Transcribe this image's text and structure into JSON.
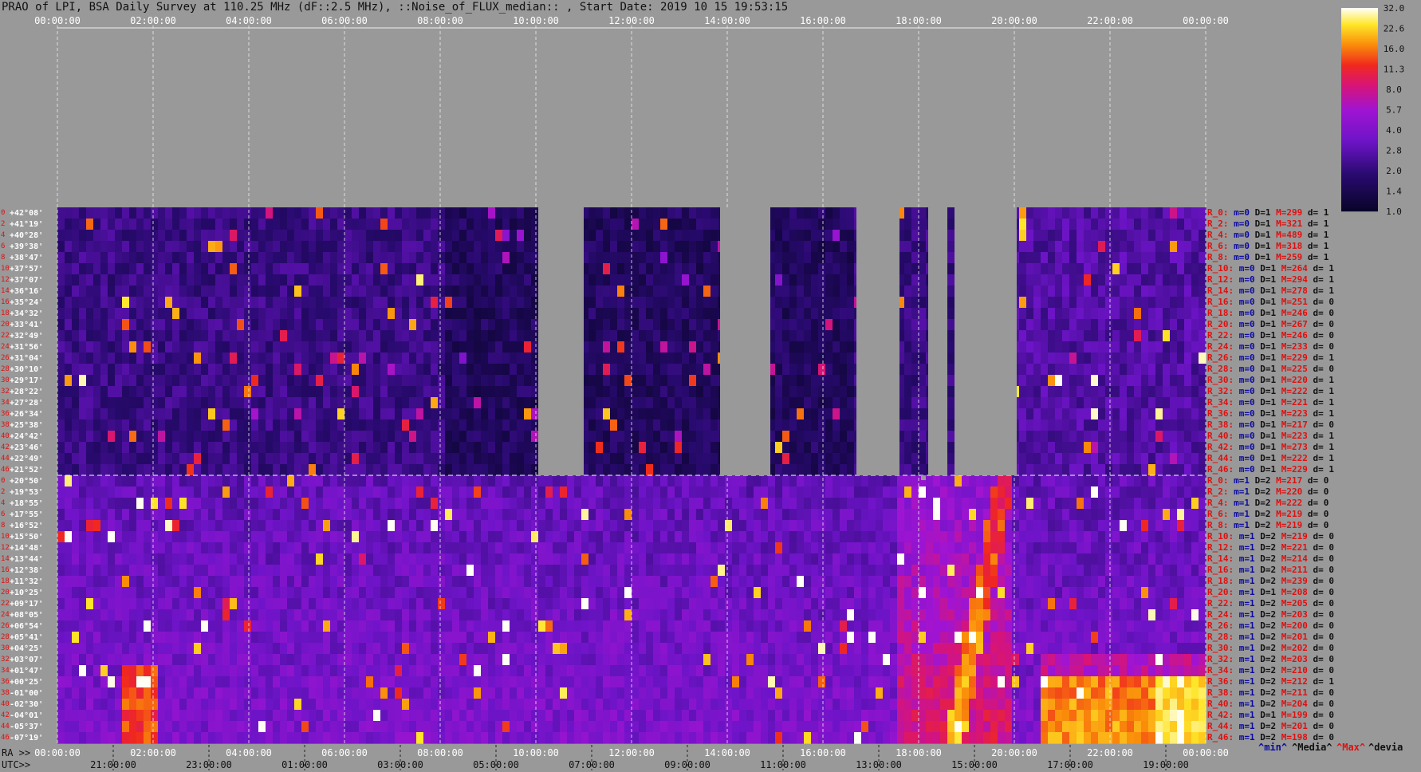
{
  "title": "PRAO of LPI, BSA Daily Survey at 110.25 MHz (dF::2.5 MHz), ::Noise_of_FLUX_median:: , Start Date: 2019 10 15 19:53:15",
  "top_time_labels": [
    "00:00:00",
    "02:00:00",
    "04:00:00",
    "06:00:00",
    "08:00:00",
    "10:00:00",
    "12:00:00",
    "14:00:00",
    "16:00:00",
    "18:00:00",
    "20:00:00",
    "22:00:00",
    "00:00:00"
  ],
  "ra_prefix": "RA >>",
  "ra_labels": [
    "00:00:00",
    "02:00:00",
    "04:00:00",
    "06:00:00",
    "08:00:00",
    "10:00:00",
    "12:00:00",
    "14:00:00",
    "16:00:00",
    "18:00:00",
    "20:00:00",
    "22:00:00",
    "00:00:00"
  ],
  "utc_prefix": "UTC>>",
  "utc_labels": [
    "21:00:00",
    "23:00:00",
    "01:00:00",
    "03:00:00",
    "05:00:00",
    "07:00:00",
    "09:00:00",
    "11:00:00",
    "13:00:00",
    "15:00:00",
    "17:00:00",
    "19:00:00"
  ],
  "colorbar": {
    "ticks": [
      "32.0",
      "22.6",
      "16.0",
      "11.3",
      "8.0",
      "5.7",
      "4.0",
      "2.8",
      "2.0",
      "1.4",
      "1.0"
    ]
  },
  "legend": {
    "min": "^min^",
    "median": "^Media^",
    "max": "^Max^",
    "devia": "^devia"
  },
  "colors": {
    "background": "#999999",
    "panel_gap": "#999999",
    "row_label_red": "#e01010",
    "stat_blue": "#0a0aa0",
    "stat_red": "#e01010"
  },
  "chart_data": {
    "type": "heatmap",
    "frequency_mhz": 110.25,
    "bandwidth_mhz": 2.5,
    "quantity": "Noise_of_FLUX_median",
    "start_date": "2019 10 15 19:53:15",
    "colorscale_range": [
      1.0,
      32.0
    ],
    "upper_panel_declinations": [
      "+42°08'",
      "+41°19'",
      "+40°28'",
      "+39°38'",
      "+38°47'",
      "+37°57'",
      "+37°07'",
      "+36°16'",
      "+35°24'",
      "+34°32'",
      "+33°41'",
      "+32°49'",
      "+31°56'",
      "+31°04'",
      "+30°10'",
      "+29°17'",
      "+28°22'",
      "+27°28'",
      "+26°34'",
      "+25°38'",
      "+24°42'",
      "+23°46'",
      "+22°49'",
      "+21°52'"
    ],
    "lower_panel_declinations": [
      "+20°50'",
      "+19°53'",
      "+18°55'",
      "+17°55'",
      "+16°52'",
      "+15°50'",
      "+14°48'",
      "+13°44'",
      "+12°38'",
      "+11°32'",
      "+10°25'",
      "+09°17'",
      "+08°05'",
      "+06°54'",
      "+05°41'",
      "+04°25'",
      "+03°07'",
      "+01°47'",
      "+00°25'",
      "-01°00'",
      "-02°30'",
      "-04°01'",
      "-05°37'",
      "-07°19'"
    ],
    "upper_row_numbers": [
      "0",
      "2",
      "4",
      "6",
      "8",
      "10",
      "12",
      "14",
      "16",
      "18",
      "20",
      "22",
      "24",
      "26",
      "28",
      "30",
      "32",
      "34",
      "36",
      "38",
      "40",
      "42",
      "44",
      "46"
    ],
    "lower_row_numbers": [
      "0",
      "2",
      "4",
      "6",
      "8",
      "10",
      "12",
      "14",
      "16",
      "18",
      "20",
      "22",
      "24",
      "26",
      "28",
      "30",
      "32",
      "34",
      "36",
      "38",
      "40",
      "42",
      "44",
      "46"
    ],
    "upper_stats": [
      {
        "r": "R_0:",
        "m": "m=0",
        "D": "D=1",
        "M": "M=299",
        "d": "d= 1"
      },
      {
        "r": "R_2:",
        "m": "m=0",
        "D": "D=1",
        "M": "M=321",
        "d": "d= 1"
      },
      {
        "r": "R_4:",
        "m": "m=0",
        "D": "D=1",
        "M": "M=489",
        "d": "d= 1"
      },
      {
        "r": "R_6:",
        "m": "m=0",
        "D": "D=1",
        "M": "M=318",
        "d": "d= 1"
      },
      {
        "r": "R_8:",
        "m": "m=0",
        "D": "D=1",
        "M": "M=259",
        "d": "d= 1"
      },
      {
        "r": "R_10:",
        "m": "m=0",
        "D": "D=1",
        "M": "M=264",
        "d": "d= 1"
      },
      {
        "r": "R_12:",
        "m": "m=0",
        "D": "D=1",
        "M": "M=294",
        "d": "d= 1"
      },
      {
        "r": "R_14:",
        "m": "m=0",
        "D": "D=1",
        "M": "M=278",
        "d": "d= 1"
      },
      {
        "r": "R_16:",
        "m": "m=0",
        "D": "D=1",
        "M": "M=251",
        "d": "d= 0"
      },
      {
        "r": "R_18:",
        "m": "m=0",
        "D": "D=1",
        "M": "M=246",
        "d": "d= 0"
      },
      {
        "r": "R_20:",
        "m": "m=0",
        "D": "D=1",
        "M": "M=267",
        "d": "d= 0"
      },
      {
        "r": "R_22:",
        "m": "m=0",
        "D": "D=1",
        "M": "M=246",
        "d": "d= 0"
      },
      {
        "r": "R_24:",
        "m": "m=0",
        "D": "D=1",
        "M": "M=233",
        "d": "d= 0"
      },
      {
        "r": "R_26:",
        "m": "m=0",
        "D": "D=1",
        "M": "M=229",
        "d": "d= 1"
      },
      {
        "r": "R_28:",
        "m": "m=0",
        "D": "D=1",
        "M": "M=225",
        "d": "d= 0"
      },
      {
        "r": "R_30:",
        "m": "m=0",
        "D": "D=1",
        "M": "M=220",
        "d": "d= 1"
      },
      {
        "r": "R_32:",
        "m": "m=0",
        "D": "D=1",
        "M": "M=222",
        "d": "d= 1"
      },
      {
        "r": "R_34:",
        "m": "m=0",
        "D": "D=1",
        "M": "M=221",
        "d": "d= 1"
      },
      {
        "r": "R_36:",
        "m": "m=0",
        "D": "D=1",
        "M": "M=223",
        "d": "d= 1"
      },
      {
        "r": "R_38:",
        "m": "m=0",
        "D": "D=1",
        "M": "M=217",
        "d": "d= 0"
      },
      {
        "r": "R_40:",
        "m": "m=0",
        "D": "D=1",
        "M": "M=223",
        "d": "d= 1"
      },
      {
        "r": "R_42:",
        "m": "m=0",
        "D": "D=1",
        "M": "M=273",
        "d": "d= 1"
      },
      {
        "r": "R_44:",
        "m": "m=0",
        "D": "D=1",
        "M": "M=222",
        "d": "d= 1"
      },
      {
        "r": "R_46:",
        "m": "m=0",
        "D": "D=1",
        "M": "M=229",
        "d": "d= 1"
      }
    ],
    "lower_stats": [
      {
        "r": "R_0:",
        "m": "m=1",
        "D": "D=2",
        "M": "M=217",
        "d": "d= 0"
      },
      {
        "r": "R_2:",
        "m": "m=1",
        "D": "D=2",
        "M": "M=220",
        "d": "d= 0"
      },
      {
        "r": "R_4:",
        "m": "m=1",
        "D": "D=2",
        "M": "M=222",
        "d": "d= 0"
      },
      {
        "r": "R_6:",
        "m": "m=1",
        "D": "D=2",
        "M": "M=219",
        "d": "d= 0"
      },
      {
        "r": "R_8:",
        "m": "m=1",
        "D": "D=2",
        "M": "M=219",
        "d": "d= 0"
      },
      {
        "r": "R_10:",
        "m": "m=1",
        "D": "D=2",
        "M": "M=219",
        "d": "d= 0"
      },
      {
        "r": "R_12:",
        "m": "m=1",
        "D": "D=2",
        "M": "M=221",
        "d": "d= 0"
      },
      {
        "r": "R_14:",
        "m": "m=1",
        "D": "D=2",
        "M": "M=214",
        "d": "d= 0"
      },
      {
        "r": "R_16:",
        "m": "m=1",
        "D": "D=2",
        "M": "M=211",
        "d": "d= 0"
      },
      {
        "r": "R_18:",
        "m": "m=1",
        "D": "D=2",
        "M": "M=239",
        "d": "d= 0"
      },
      {
        "r": "R_20:",
        "m": "m=1",
        "D": "D=1",
        "M": "M=208",
        "d": "d= 0"
      },
      {
        "r": "R_22:",
        "m": "m=1",
        "D": "D=2",
        "M": "M=205",
        "d": "d= 0"
      },
      {
        "r": "R_24:",
        "m": "m=1",
        "D": "D=2",
        "M": "M=203",
        "d": "d= 0"
      },
      {
        "r": "R_26:",
        "m": "m=1",
        "D": "D=2",
        "M": "M=200",
        "d": "d= 0"
      },
      {
        "r": "R_28:",
        "m": "m=1",
        "D": "D=2",
        "M": "M=201",
        "d": "d= 0"
      },
      {
        "r": "R_30:",
        "m": "m=1",
        "D": "D=2",
        "M": "M=202",
        "d": "d= 0"
      },
      {
        "r": "R_32:",
        "m": "m=1",
        "D": "D=2",
        "M": "M=203",
        "d": "d= 0"
      },
      {
        "r": "R_34:",
        "m": "m=1",
        "D": "D=2",
        "M": "M=210",
        "d": "d= 0"
      },
      {
        "r": "R_36:",
        "m": "m=1",
        "D": "D=2",
        "M": "M=212",
        "d": "d= 1"
      },
      {
        "r": "R_38:",
        "m": "m=1",
        "D": "D=2",
        "M": "M=211",
        "d": "d= 0"
      },
      {
        "r": "R_40:",
        "m": "m=1",
        "D": "D=2",
        "M": "M=204",
        "d": "d= 0"
      },
      {
        "r": "R_42:",
        "m": "m=1",
        "D": "D=1",
        "M": "M=199",
        "d": "d= 0"
      },
      {
        "r": "R_44:",
        "m": "m=1",
        "D": "D=2",
        "M": "M=201",
        "d": "d= 0"
      },
      {
        "r": "R_46:",
        "m": "m=1",
        "D": "D=2",
        "M": "M=198",
        "d": "d= 0"
      }
    ],
    "data_gaps_upper_ra_hours": [
      [
        10.05,
        11.0
      ],
      [
        13.85,
        14.9
      ],
      [
        16.7,
        17.6
      ],
      [
        18.2,
        18.6
      ],
      [
        18.75,
        20.05
      ]
    ],
    "data_gaps_lower_ra_hours": [
      [
        18.05,
        18.15
      ]
    ],
    "bright_features": [
      {
        "ra_hours": 1.45,
        "dec_panel": "lower",
        "rows": [
          17,
          23
        ],
        "level": 8.0
      },
      {
        "ra_hours": 21.0,
        "dec_panel": "lower",
        "rows": [
          17,
          23
        ],
        "level": 32.0
      },
      {
        "ra_hours": 19.2,
        "dec_panel": "lower",
        "rows": [
          0,
          23
        ],
        "level": 11.3
      },
      {
        "ra_hours": 20.1,
        "dec_panel": "upper",
        "rows": [
          0,
          3
        ],
        "level": 22.6
      }
    ]
  }
}
